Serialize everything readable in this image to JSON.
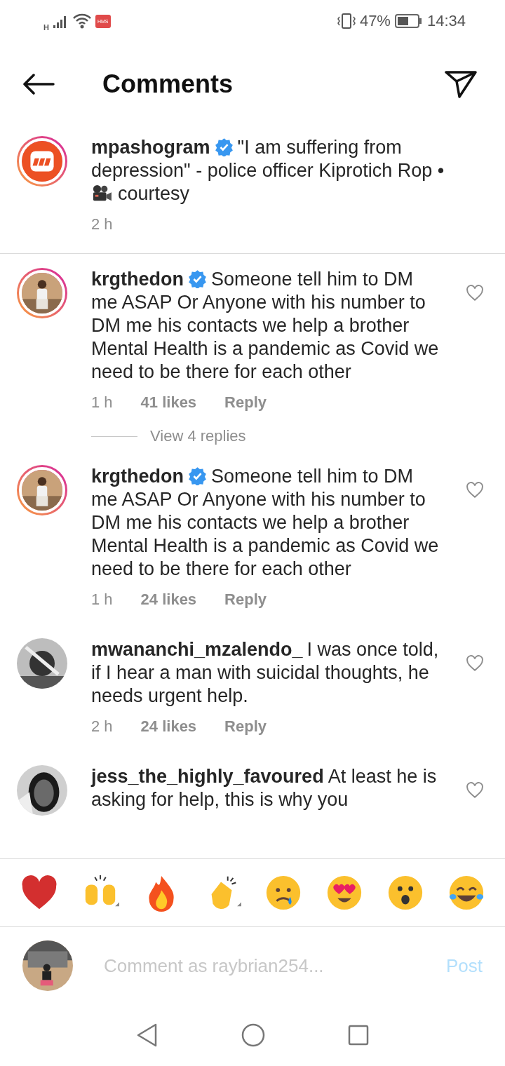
{
  "status_bar": {
    "network": "H",
    "battery_percent": "47%",
    "time": "14:34",
    "app_badge": "HMS"
  },
  "header": {
    "title": "Comments"
  },
  "caption": {
    "username": "mpashogram",
    "verified": true,
    "story_ring": true,
    "text": "\"I am suffering from depression\" - police officer Kiprotich Rop •",
    "text_after_icon": "courtesy",
    "time": "2 h"
  },
  "comments": [
    {
      "username": "krgthedon",
      "verified": true,
      "story_ring": true,
      "text": "Someone tell him to DM me ASAP Or Anyone with his number to DM me his contacts we help a brother Mental Health is a pandemic as Covid we need to be there for each other",
      "time": "1 h",
      "likes": "41 likes",
      "reply": "Reply",
      "view_replies": "View 4 replies"
    },
    {
      "username": "krgthedon",
      "verified": true,
      "story_ring": true,
      "text": "Someone tell him to DM me ASAP Or Anyone with his number to DM me his contacts we help a brother Mental Health is a pandemic as Covid we need to be there for each other",
      "time": "1 h",
      "likes": "24 likes",
      "reply": "Reply"
    },
    {
      "username": "mwananchi_mzalendo_",
      "verified": false,
      "story_ring": false,
      "text": "I was once told, if I hear a man with suicidal thoughts, he needs urgent help.",
      "time": "2 h",
      "likes": "24 likes",
      "reply": "Reply"
    },
    {
      "username": "jess_the_highly_favoured",
      "verified": false,
      "story_ring": false,
      "text": "At least he is asking for help, this is why you"
    }
  ],
  "composer": {
    "placeholder": "Comment as raybrian254...",
    "post": "Post"
  }
}
